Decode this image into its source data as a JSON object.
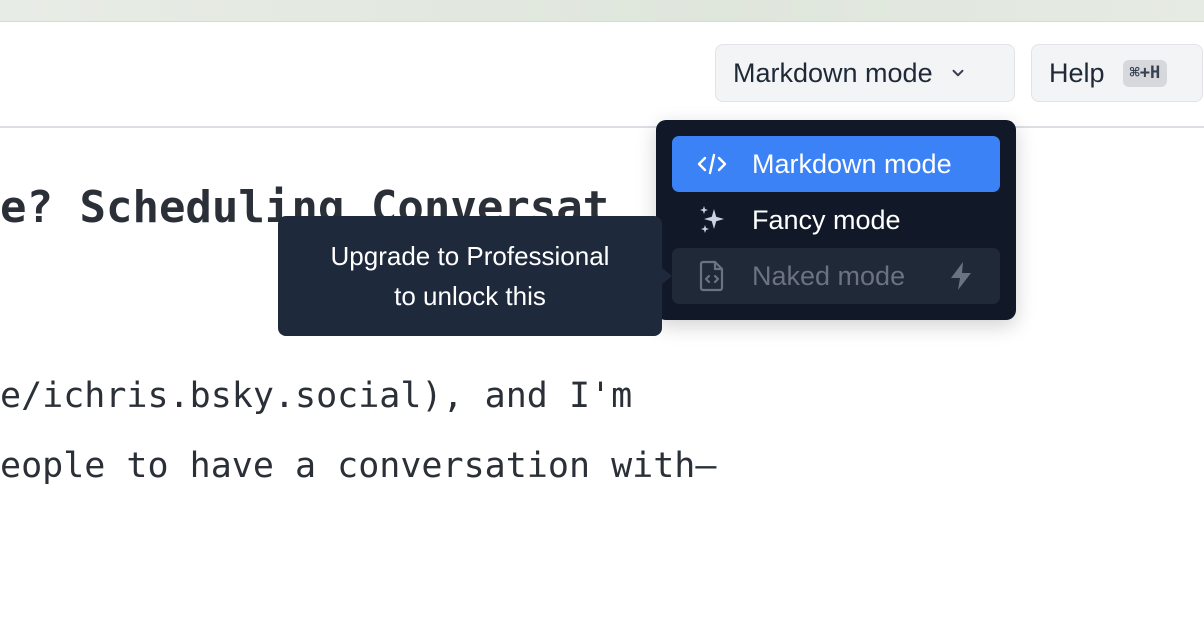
{
  "toolbar": {
    "mode_label": "Markdown mode",
    "help_label": "Help",
    "help_shortcut": "⌘+H"
  },
  "document": {
    "heading": "e? Scheduling Conversat",
    "line1": "e/ichris.bsky.social), and I'm",
    "line2": "eople to have a conversation with—"
  },
  "menu": {
    "items": [
      {
        "label": "Markdown mode",
        "icon": "code-icon",
        "state": "active"
      },
      {
        "label": "Fancy mode",
        "icon": "sparkles-icon",
        "state": "normal"
      },
      {
        "label": "Naked mode",
        "icon": "code-file-icon",
        "state": "disabled",
        "badge_icon": "lightning-icon"
      }
    ]
  },
  "tooltip": {
    "line1": "Upgrade to Professional",
    "line2": "to unlock this"
  },
  "colors": {
    "accent": "#3b82f6",
    "menu_bg": "#111827",
    "tooltip_bg": "#1e293b"
  }
}
